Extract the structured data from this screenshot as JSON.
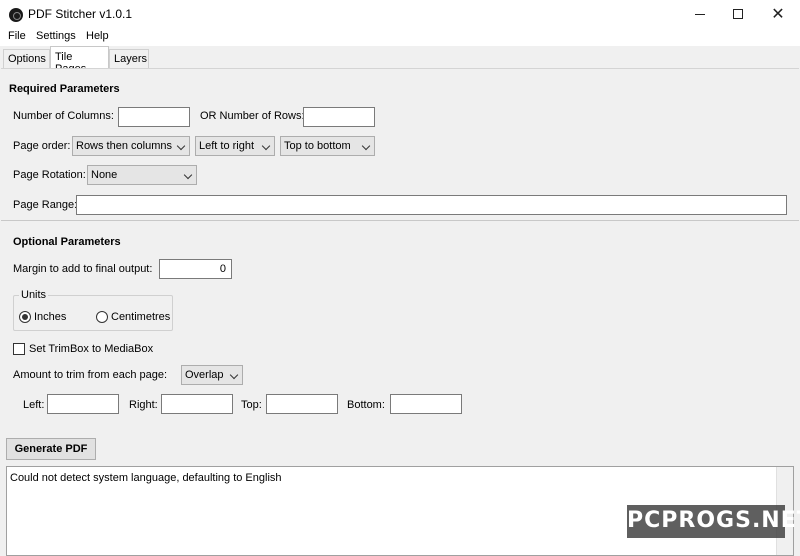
{
  "window": {
    "title": "PDF Stitcher v1.0.1",
    "app_icon": "app-logo-icon",
    "controls": {
      "minimize": "minimize-icon",
      "maximize": "maximize-icon",
      "close": "close-icon"
    }
  },
  "menu": [
    "File",
    "Settings",
    "Help"
  ],
  "tabs": [
    {
      "label": "Options",
      "active": false
    },
    {
      "label": "Tile Pages",
      "active": true
    },
    {
      "label": "Layers",
      "active": false
    }
  ],
  "required": {
    "title": "Required Parameters",
    "columns_label": "Number of Columns:",
    "columns_value": "",
    "rows_label": "OR Number of Rows:",
    "rows_value": "",
    "page_order_label": "Page order:",
    "page_order": "Rows then columns",
    "direction": "Left to right",
    "vertical": "Top to bottom",
    "rotation_label": "Page Rotation:",
    "rotation": "None",
    "range_label": "Page Range:",
    "range_value": ""
  },
  "optional": {
    "title": "Optional Parameters",
    "margin_label": "Margin to add to final output:",
    "margin_value": "0",
    "units_label": "Units",
    "units": [
      {
        "label": "Inches",
        "selected": true
      },
      {
        "label": "Centimetres",
        "selected": false
      }
    ],
    "trimbox_label": "Set TrimBox to MediaBox",
    "trimbox_checked": false,
    "trim_label": "Amount to trim from each page:",
    "trim_mode": "Overlap",
    "left_label": "Left:",
    "right_label": "Right:",
    "top_label": "Top:",
    "bottom_label": "Bottom:"
  },
  "generate_label": "Generate PDF",
  "log_text": "Could not detect system language, defaulting to English",
  "watermark": "PCPROGS.NET"
}
